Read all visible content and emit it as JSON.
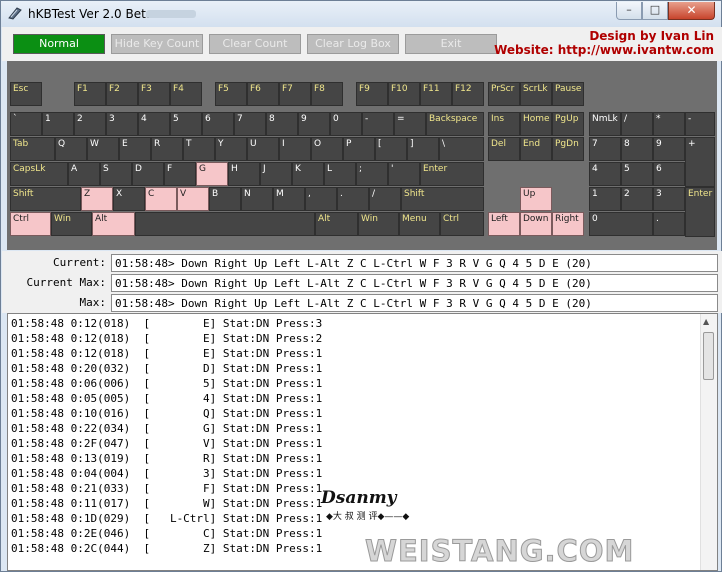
{
  "window": {
    "title": "hKBTest Ver 2.0 Beta",
    "controls": {
      "minimize": "–",
      "maximize": "□",
      "close": "✕"
    }
  },
  "toolbar": {
    "normal": "Normal",
    "hide_key_count": "Hide Key Count",
    "clear_count": "Clear Count",
    "clear_log_box": "Clear Log Box",
    "exit": "Exit"
  },
  "credits": {
    "line1": "Design by Ivan Lin",
    "line2": "Website: http://www.ivantw.com"
  },
  "keyboard": {
    "pressed_color": "#f6c6c9",
    "keys": [
      {
        "id": "esc",
        "label": "Esc"
      },
      {
        "id": "f1",
        "label": "F1"
      },
      {
        "id": "f2",
        "label": "F2"
      },
      {
        "id": "f3",
        "label": "F3"
      },
      {
        "id": "f4",
        "label": "F4"
      },
      {
        "id": "f5",
        "label": "F5"
      },
      {
        "id": "f6",
        "label": "F6"
      },
      {
        "id": "f7",
        "label": "F7"
      },
      {
        "id": "f8",
        "label": "F8"
      },
      {
        "id": "f9",
        "label": "F9"
      },
      {
        "id": "f10",
        "label": "F10"
      },
      {
        "id": "f11",
        "label": "F11"
      },
      {
        "id": "f12",
        "label": "F12"
      },
      {
        "id": "prscr",
        "label": "PrScr"
      },
      {
        "id": "scrlk",
        "label": "ScrLk"
      },
      {
        "id": "pause",
        "label": "Pause"
      },
      {
        "id": "backtick",
        "label": "`"
      },
      {
        "id": "n1",
        "label": "1"
      },
      {
        "id": "n2",
        "label": "2"
      },
      {
        "id": "n3",
        "label": "3"
      },
      {
        "id": "n4",
        "label": "4"
      },
      {
        "id": "n5",
        "label": "5"
      },
      {
        "id": "n6",
        "label": "6"
      },
      {
        "id": "n7",
        "label": "7"
      },
      {
        "id": "n8",
        "label": "8"
      },
      {
        "id": "n9",
        "label": "9"
      },
      {
        "id": "n0",
        "label": "0"
      },
      {
        "id": "minus",
        "label": "-"
      },
      {
        "id": "equal",
        "label": "="
      },
      {
        "id": "backspace",
        "label": "Backspace"
      },
      {
        "id": "ins",
        "label": "Ins"
      },
      {
        "id": "home",
        "label": "Home"
      },
      {
        "id": "pgup",
        "label": "PgUp"
      },
      {
        "id": "numlk",
        "label": "NmLk"
      },
      {
        "id": "ndiv",
        "label": "/"
      },
      {
        "id": "nmul",
        "label": "*"
      },
      {
        "id": "nsub",
        "label": "-"
      },
      {
        "id": "tab",
        "label": "Tab"
      },
      {
        "id": "q",
        "label": "Q"
      },
      {
        "id": "w",
        "label": "W"
      },
      {
        "id": "e",
        "label": "E"
      },
      {
        "id": "r",
        "label": "R"
      },
      {
        "id": "t",
        "label": "T"
      },
      {
        "id": "y",
        "label": "Y"
      },
      {
        "id": "u",
        "label": "U"
      },
      {
        "id": "i",
        "label": "I"
      },
      {
        "id": "o",
        "label": "O"
      },
      {
        "id": "p",
        "label": "P"
      },
      {
        "id": "lbr",
        "label": "["
      },
      {
        "id": "rbr",
        "label": "]"
      },
      {
        "id": "bslash",
        "label": "\\"
      },
      {
        "id": "del",
        "label": "Del"
      },
      {
        "id": "end",
        "label": "End"
      },
      {
        "id": "pgdn",
        "label": "PgDn"
      },
      {
        "id": "n7k",
        "label": "7"
      },
      {
        "id": "n8k",
        "label": "8"
      },
      {
        "id": "n9k",
        "label": "9"
      },
      {
        "id": "nadd",
        "label": "+"
      },
      {
        "id": "capslk",
        "label": "CapsLk"
      },
      {
        "id": "a",
        "label": "A"
      },
      {
        "id": "s",
        "label": "S"
      },
      {
        "id": "d",
        "label": "D"
      },
      {
        "id": "f",
        "label": "F"
      },
      {
        "id": "g",
        "label": "G"
      },
      {
        "id": "h",
        "label": "H"
      },
      {
        "id": "j",
        "label": "J"
      },
      {
        "id": "k",
        "label": "K"
      },
      {
        "id": "l",
        "label": "L"
      },
      {
        "id": "semi",
        "label": ";"
      },
      {
        "id": "quote",
        "label": "'"
      },
      {
        "id": "enter",
        "label": "Enter"
      },
      {
        "id": "n4k",
        "label": "4"
      },
      {
        "id": "n5k",
        "label": "5"
      },
      {
        "id": "n6k",
        "label": "6"
      },
      {
        "id": "lshift",
        "label": "Shift"
      },
      {
        "id": "z",
        "label": "Z"
      },
      {
        "id": "x",
        "label": "X"
      },
      {
        "id": "c",
        "label": "C"
      },
      {
        "id": "v",
        "label": "V"
      },
      {
        "id": "b",
        "label": "B"
      },
      {
        "id": "n",
        "label": "N"
      },
      {
        "id": "m",
        "label": "M"
      },
      {
        "id": "comma",
        "label": ","
      },
      {
        "id": "period",
        "label": "."
      },
      {
        "id": "slash",
        "label": "/"
      },
      {
        "id": "rshift",
        "label": "Shift"
      },
      {
        "id": "up",
        "label": "Up"
      },
      {
        "id": "n1k",
        "label": "1"
      },
      {
        "id": "n2k",
        "label": "2"
      },
      {
        "id": "n3k",
        "label": "3"
      },
      {
        "id": "nenter",
        "label": "Enter"
      },
      {
        "id": "lctrl",
        "label": "Ctrl"
      },
      {
        "id": "lwin",
        "label": "Win"
      },
      {
        "id": "lalt",
        "label": "Alt"
      },
      {
        "id": "space",
        "label": ""
      },
      {
        "id": "ralt",
        "label": "Alt"
      },
      {
        "id": "rwin",
        "label": "Win"
      },
      {
        "id": "menu",
        "label": "Menu"
      },
      {
        "id": "rctrl",
        "label": "Ctrl"
      },
      {
        "id": "left",
        "label": "Left"
      },
      {
        "id": "down",
        "label": "Down"
      },
      {
        "id": "right",
        "label": "Right"
      },
      {
        "id": "n0k",
        "label": "0"
      },
      {
        "id": "ndot",
        "label": "."
      }
    ],
    "pressed": [
      "g",
      "z",
      "c",
      "v",
      "lctrl",
      "lalt",
      "up",
      "left",
      "down",
      "right"
    ]
  },
  "status": {
    "current_label": "Current:",
    "current_value": "01:58:48> Down Right Up Left L-Alt Z C L-Ctrl W F 3 R V G Q 4 5 D E (20)",
    "current_max_label": "Current Max:",
    "current_max_value": "01:58:48> Down Right Up Left L-Alt Z C L-Ctrl W F 3 R V G Q 4 5 D E (20)",
    "max_label": "Max:",
    "max_value": "01:58:48> Down Right Up Left L-Alt Z C L-Ctrl W F 3 R V G Q 4 5 D E (20)"
  },
  "log": [
    "01:58:48 0:12(018)  [        E] Stat:DN Press:3",
    "01:58:48 0:12(018)  [        E] Stat:DN Press:2",
    "01:58:48 0:12(018)  [        E] Stat:DN Press:1",
    "01:58:48 0:20(032)  [        D] Stat:DN Press:1",
    "01:58:48 0:06(006)  [        5] Stat:DN Press:1",
    "01:58:48 0:05(005)  [        4] Stat:DN Press:1",
    "01:58:48 0:10(016)  [        Q] Stat:DN Press:1",
    "01:58:48 0:22(034)  [        G] Stat:DN Press:1",
    "01:58:48 0:2F(047)  [        V] Stat:DN Press:1",
    "01:58:48 0:13(019)  [        R] Stat:DN Press:1",
    "01:58:48 0:04(004)  [        3] Stat:DN Press:1",
    "01:58:48 0:21(033)  [        F] Stat:DN Press:1",
    "01:58:48 0:11(017)  [        W] Stat:DN Press:1",
    "01:58:48 0:1D(029)  [   L-Ctrl] Stat:DN Press:1",
    "01:58:48 0:2E(046)  [        C] Stat:DN Press:1",
    "01:58:48 0:2C(044)  [        Z] Stat:DN Press:1"
  ],
  "watermark": {
    "name": "Dsanmy",
    "subtitle": "◆大 叔 测 评◆——◆",
    "site": "WEISTANG.COM"
  }
}
